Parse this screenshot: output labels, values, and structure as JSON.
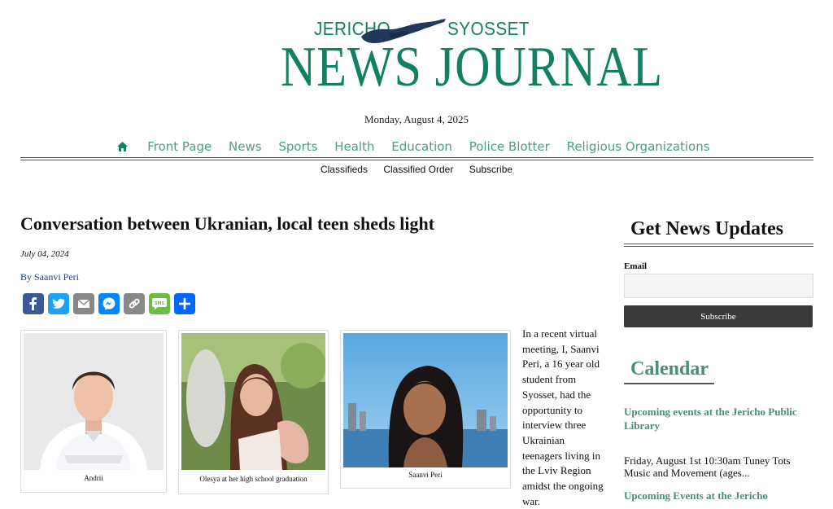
{
  "masthead": {
    "left_word": "JERICHO",
    "right_word": "SYOSSET",
    "title": "NEWS JOURNAL",
    "brand_color": "#137f63"
  },
  "date": "Monday, August 4, 2025",
  "nav": {
    "home_icon": "home-icon",
    "items": [
      "Front Page",
      "News",
      "Sports",
      "Health",
      "Education",
      "Police Blotter",
      "Religious Organizations"
    ]
  },
  "subnav": [
    "Classifieds",
    "Classified Order",
    "Subscribe"
  ],
  "article": {
    "headline": "Conversation between Ukranian, local teen sheds light",
    "date": "July 04, 2024",
    "byline": "By Saanvi Peri",
    "share": [
      {
        "name": "facebook-icon",
        "color": "#3b5998"
      },
      {
        "name": "twitter-icon",
        "color": "#1da1f2"
      },
      {
        "name": "email-icon",
        "color": "#888888"
      },
      {
        "name": "messenger-icon",
        "color": "#0084ff"
      },
      {
        "name": "copy-link-icon",
        "color": "#888888"
      },
      {
        "name": "sms-icon",
        "color": "#6cbe45"
      },
      {
        "name": "share-icon",
        "color": "#0166ff"
      }
    ],
    "photos": [
      {
        "caption": "Andrii"
      },
      {
        "caption": "Olesya at her high school graduation"
      },
      {
        "caption": "Saanvi Peri"
      }
    ],
    "body": "In a recent virtual meeting, I, Saanvi Peri, a 16 year old student from Syosset, had the opportunity to interview three Ukrainian teenagers living in the Lviv Region amidst the ongoing war."
  },
  "sidebar": {
    "news_title": "Get News Updates",
    "email_label": "Email",
    "email_value": "",
    "subscribe_label": "Subscribe",
    "calendar_title": "Calendar",
    "events": [
      {
        "title": "Upcoming events at the Jericho Public Library",
        "text": "Friday, August 1st 10:30am Tuney Tots Music and Movement (ages..."
      },
      {
        "title": "Upcoming Events at the Jericho",
        "text": ""
      }
    ]
  }
}
